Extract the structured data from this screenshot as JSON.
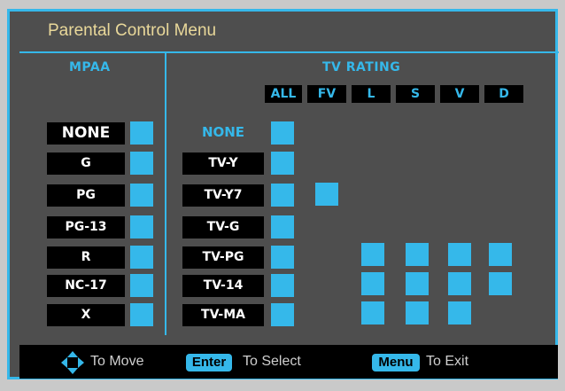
{
  "title": "Parental Control Menu",
  "mpaa": {
    "heading": "MPAA",
    "ratings": [
      "NONE",
      "G",
      "PG",
      "PG-13",
      "R",
      "NC-17",
      "X"
    ]
  },
  "tv": {
    "heading": "TV RATING",
    "columns": [
      "ALL",
      "FV",
      "L",
      "S",
      "V",
      "D"
    ],
    "ratings": [
      "NONE",
      "TV-Y",
      "TV-Y7",
      "TV-G",
      "TV-PG",
      "TV-14",
      "TV-MA"
    ]
  },
  "footer": {
    "move_text": "To Move",
    "enter_key": "Enter",
    "select_text": "To Select",
    "menu_key": "Menu",
    "exit_text": "To Exit"
  },
  "colors": {
    "accent": "#35b8ea",
    "background": "#4e4e4e",
    "title": "#e9d89a"
  }
}
